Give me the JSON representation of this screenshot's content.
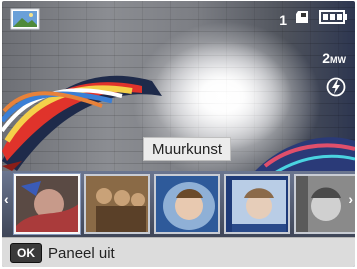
{
  "status": {
    "shots_remaining": "1"
  },
  "camera": {
    "resolution_main": "2",
    "resolution_unit": "MW"
  },
  "filter_label": "Muurkunst",
  "thumbnails": [
    {
      "name": "thumb-muurkunst",
      "tone": "art"
    },
    {
      "name": "thumb-sepia",
      "tone": "sepia"
    },
    {
      "name": "thumb-blue-vignette",
      "tone": "blue"
    },
    {
      "name": "thumb-blue-frame",
      "tone": "blue2"
    },
    {
      "name": "thumb-gray",
      "tone": "gray"
    }
  ],
  "bottom_bar": {
    "ok_label": "OK",
    "action_label": "Paneel uit"
  },
  "colors": {
    "strip": "#5a6480",
    "label_bg": "#ececec",
    "bar_bg": "#dcdcdc"
  },
  "icons": [
    "scene-thumbnail-icon",
    "memory-card-icon",
    "battery-icon",
    "flash-auto-icon",
    "chevron-left-icon",
    "chevron-right-icon"
  ]
}
